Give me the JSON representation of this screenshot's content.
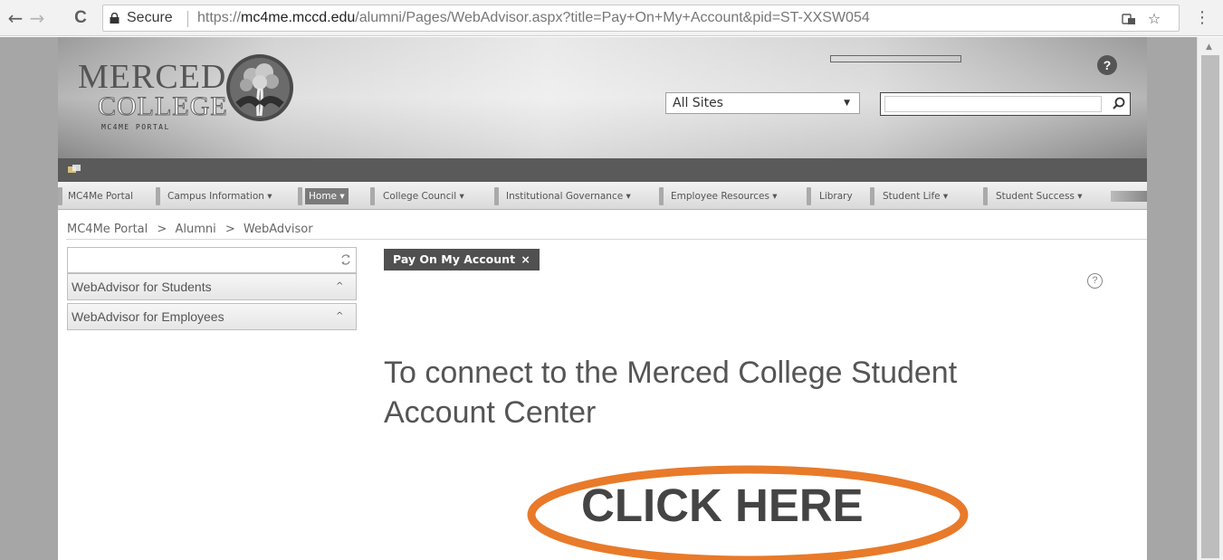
{
  "browser": {
    "back": "←",
    "forward": "→",
    "reload": "C",
    "secure_label": "Secure",
    "url_prefix": "https://",
    "url_host": "mc4me.mccd.edu",
    "url_path": "/alumni/Pages/WebAdvisor.aspx?title=Pay+On+My+Account&pid=ST-XXSW054",
    "star": "☆",
    "menu": "⋮"
  },
  "header": {
    "logo_merced": "MERCED",
    "logo_college": "COLLEGE",
    "logo_sub": "MC4ME PORTAL",
    "help_glyph": "?",
    "site_select_value": "All Sites",
    "select_arrow": "▼"
  },
  "nav": {
    "items": [
      {
        "label": "MC4Me Portal"
      },
      {
        "label": "Campus Information ▾"
      },
      {
        "label": "Home ▾"
      },
      {
        "label": "College Council ▾"
      },
      {
        "label": "Institutional Governance ▾"
      },
      {
        "label": "Employee Resources ▾"
      },
      {
        "label": "Library"
      },
      {
        "label": "Student Life ▾"
      },
      {
        "label": "Student Success ▾"
      }
    ]
  },
  "breadcrumb": {
    "items": [
      "MC4Me Portal",
      "Alumni",
      "WebAdvisor"
    ],
    "separator": ">"
  },
  "left_panel": {
    "rows": [
      {
        "label": "WebAdvisor for Students",
        "chevron": "^"
      },
      {
        "label": "WebAdvisor for Employees",
        "chevron": "^"
      }
    ]
  },
  "content": {
    "tab_label": "Pay On My Account",
    "tab_close": "×",
    "help_glyph": "?",
    "connect_text": "To connect to the Merced College Student Account Center",
    "click_here": "CLICK HERE"
  },
  "colors": {
    "highlight_oval": "#e87a2a",
    "nav_selected": "#7a7a7a",
    "dark_strip": "#5a5a5a"
  },
  "icons": [
    "lock-icon",
    "site-info-icon",
    "star-icon",
    "search-icon",
    "refresh-icon",
    "help-icon",
    "tree-logo-icon"
  ]
}
